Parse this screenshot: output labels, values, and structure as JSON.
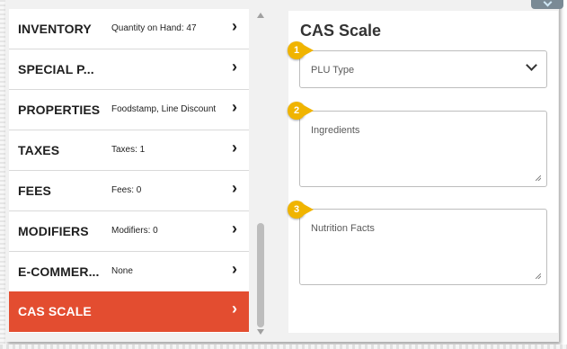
{
  "menu": {
    "items": [
      {
        "label": "INVENTORY",
        "sub": "Quantity on Hand: 47",
        "active": false
      },
      {
        "label": "SPECIAL P...",
        "sub": "",
        "active": false
      },
      {
        "label": "PROPERTIES",
        "sub": "Foodstamp, Line Discount",
        "active": false
      },
      {
        "label": "TAXES",
        "sub": "Taxes: 1",
        "active": false
      },
      {
        "label": "FEES",
        "sub": "Fees: 0",
        "active": false
      },
      {
        "label": "MODIFIERS",
        "sub": "Modifiers: 0",
        "active": false
      },
      {
        "label": "E-COMMER...",
        "sub": "None",
        "active": false
      },
      {
        "label": "CAS SCALE",
        "sub": "",
        "active": true
      }
    ],
    "chevron": "›"
  },
  "panel": {
    "title": "CAS Scale",
    "plu_type": {
      "placeholder": "PLU Type"
    },
    "ingredients": {
      "placeholder": "Ingredients"
    },
    "nutrition_facts": {
      "placeholder": "Nutrition Facts"
    }
  },
  "callouts": [
    "1",
    "2",
    "3"
  ],
  "colors": {
    "active_item": "#e34d30",
    "callout": "#f0b400",
    "background": "#f1f1f1"
  },
  "icons": {
    "menu_chevron": "chevron-right-icon",
    "dropdown_caret": "chevron-down-icon",
    "top_tab": "chevron-down-icon"
  }
}
